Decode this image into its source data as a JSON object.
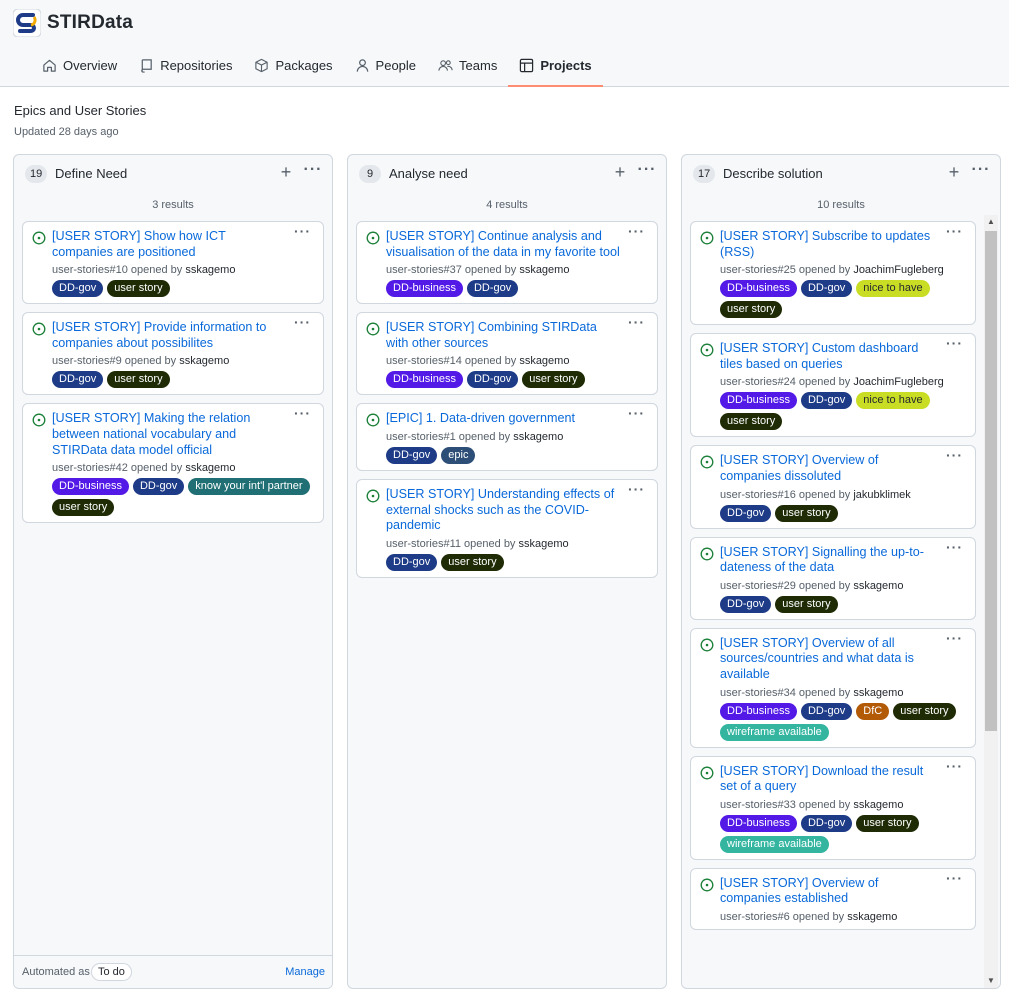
{
  "org": {
    "name": "STIRData"
  },
  "nav": [
    {
      "label": "Overview",
      "icon": "home-icon"
    },
    {
      "label": "Repositories",
      "icon": "repo-icon"
    },
    {
      "label": "Packages",
      "icon": "package-icon"
    },
    {
      "label": "People",
      "icon": "person-icon"
    },
    {
      "label": "Teams",
      "icon": "people-icon"
    },
    {
      "label": "Projects",
      "icon": "table-icon",
      "active": true
    }
  ],
  "project": {
    "title": "Epics and User Stories",
    "updated": "Updated 28 days ago"
  },
  "label_colors": {
    "DD-gov": "#1d3b87",
    "DD-business": "#5319e7",
    "user story": "#1e2b04",
    "know your int'l partner": "#1f6f74",
    "epic": "#2d4e77",
    "nice to have": "#c9dd25",
    "DfC": "#b35a06",
    "wireframe available": "#33b5a0"
  },
  "columns": [
    {
      "count": "19",
      "name": "Define Need",
      "results": "3 results",
      "footer": {
        "automated": "Automated as",
        "state": "To do",
        "manage": "Manage"
      },
      "cards": [
        {
          "title": "[USER STORY] Show how ICT companies are positioned",
          "ref": "user-stories#10 opened by",
          "author": "sskagemo",
          "labels": [
            "DD-gov",
            "user story"
          ]
        },
        {
          "title": "[USER STORY] Provide information to companies about possibilites",
          "ref": "user-stories#9 opened by",
          "author": "sskagemo",
          "labels": [
            "DD-gov",
            "user story"
          ]
        },
        {
          "title": "[USER STORY] Making the relation between national vocabulary and STIRData data model official",
          "ref": "user-stories#42 opened by",
          "author": "sskagemo",
          "labels": [
            "DD-business",
            "DD-gov",
            "know your int'l partner",
            "user story"
          ]
        }
      ]
    },
    {
      "count": "9",
      "name": "Analyse need",
      "results": "4 results",
      "cards": [
        {
          "title": "[USER STORY] Continue analysis and visualisation of the data in my favorite tool",
          "ref": "user-stories#37 opened by",
          "author": "sskagemo",
          "labels": [
            "DD-business",
            "DD-gov"
          ]
        },
        {
          "title": "[USER STORY] Combining STIRData with other sources",
          "ref": "user-stories#14 opened by",
          "author": "sskagemo",
          "labels": [
            "DD-business",
            "DD-gov",
            "user story"
          ]
        },
        {
          "title": "[EPIC] 1. Data-driven government",
          "ref": "user-stories#1 opened by",
          "author": "sskagemo",
          "labels": [
            "DD-gov",
            "epic"
          ]
        },
        {
          "title": "[USER STORY] Understanding effects of external shocks such as the COVID-pandemic",
          "ref": "user-stories#11 opened by",
          "author": "sskagemo",
          "labels": [
            "DD-gov",
            "user story"
          ]
        }
      ]
    },
    {
      "count": "17",
      "name": "Describe solution",
      "results": "10 results",
      "cards": [
        {
          "title": "[USER STORY] Subscribe to updates (RSS)",
          "ref": "user-stories#25 opened by",
          "author": "JoachimFugleberg",
          "labels": [
            "DD-business",
            "DD-gov",
            "nice to have",
            "user story"
          ]
        },
        {
          "title": "[USER STORY] Custom dashboard tiles based on queries",
          "ref": "user-stories#24 opened by",
          "author": "JoachimFugleberg",
          "labels": [
            "DD-business",
            "DD-gov",
            "nice to have",
            "user story"
          ]
        },
        {
          "title": "[USER STORY] Overview of companies dissoluted",
          "ref": "user-stories#16 opened by",
          "author": "jakubklimek",
          "labels": [
            "DD-gov",
            "user story"
          ]
        },
        {
          "title": "[USER STORY] Signalling the up-to-dateness of the data",
          "ref": "user-stories#29 opened by",
          "author": "sskagemo",
          "labels": [
            "DD-gov",
            "user story"
          ]
        },
        {
          "title": "[USER STORY] Overview of all sources/countries and what data is available",
          "ref": "user-stories#34 opened by",
          "author": "sskagemo",
          "labels": [
            "DD-business",
            "DD-gov",
            "DfC",
            "user story",
            "wireframe available"
          ]
        },
        {
          "title": "[USER STORY] Download the result set of a query",
          "ref": "user-stories#33 opened by",
          "author": "sskagemo",
          "labels": [
            "DD-business",
            "DD-gov",
            "user story",
            "wireframe available"
          ]
        },
        {
          "title": "[USER STORY] Overview of companies established",
          "ref": "user-stories#6 opened by",
          "author": "sskagemo",
          "labels": []
        }
      ]
    }
  ]
}
